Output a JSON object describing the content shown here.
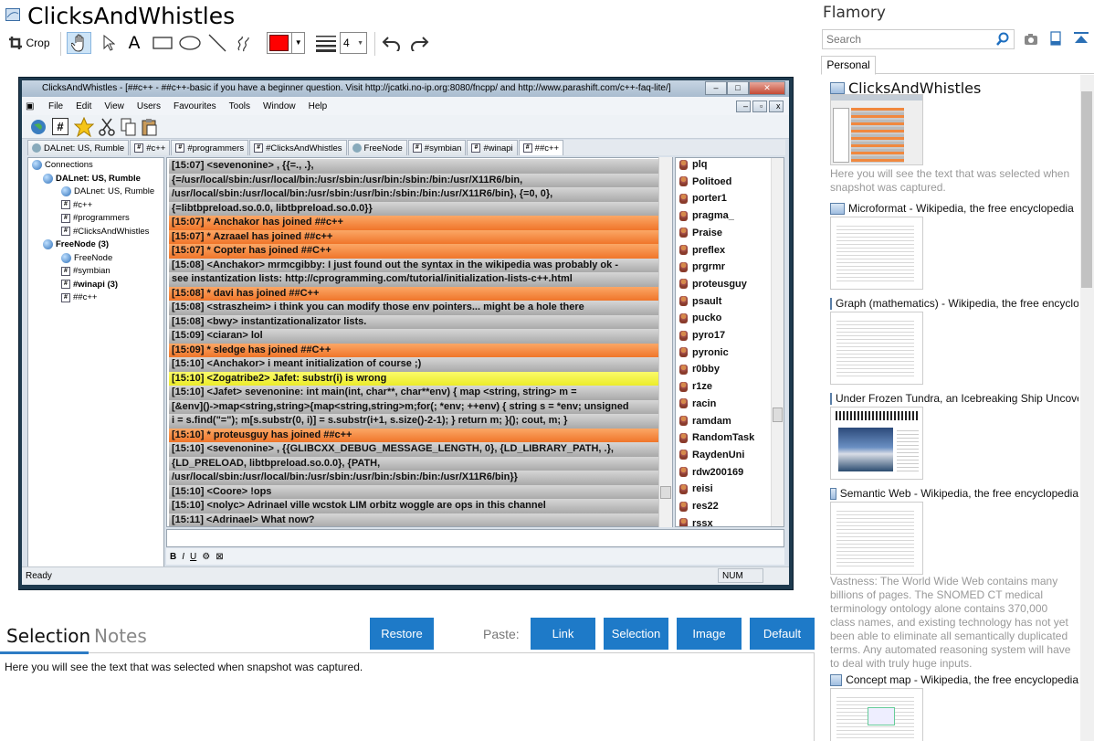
{
  "header": {
    "title": "ClicksAndWhistles",
    "toolbar": {
      "crop_label": "Crop",
      "tools": [
        "hand-icon",
        "pointer-icon",
        "text-icon",
        "rectangle-icon",
        "ellipse-icon",
        "line-icon",
        "freehand-icon"
      ],
      "color": "#ff0000",
      "line_width": "4"
    }
  },
  "screenshot": {
    "window_title": "ClicksAndWhistles - [##c++ - ##c++-basic if you have a beginner question. Visit http://jcatki.no-ip.org:8080/fncpp/ and http://www.parashift.com/c++-faq-lite/]",
    "menu": [
      "File",
      "Edit",
      "View",
      "Users",
      "Favourites",
      "Tools",
      "Window",
      "Help"
    ],
    "channel_tabs": [
      "DALnet: US, Rumble",
      "#c++",
      "#programmers",
      "#ClicksAndWhistles",
      "FreeNode",
      "#symbian",
      "#winapi",
      "##c++"
    ],
    "tree": [
      {
        "label": "Connections",
        "bold": false,
        "indent": 0
      },
      {
        "label": "DALnet: US, Rumble",
        "bold": true,
        "indent": 1
      },
      {
        "label": "DALnet: US, Rumble",
        "bold": false,
        "indent": 2
      },
      {
        "label": "#c++",
        "bold": false,
        "indent": 2
      },
      {
        "label": "#programmers",
        "bold": false,
        "indent": 2
      },
      {
        "label": "#ClicksAndWhistles",
        "bold": false,
        "indent": 2
      },
      {
        "label": "FreeNode (3)",
        "bold": true,
        "indent": 1
      },
      {
        "label": "FreeNode",
        "bold": false,
        "indent": 2
      },
      {
        "label": "#symbian",
        "bold": false,
        "indent": 2
      },
      {
        "label": "#winapi (3)",
        "bold": true,
        "indent": 2
      },
      {
        "label": "##c++",
        "bold": false,
        "indent": 2
      }
    ],
    "chat": [
      {
        "text": "[15:07] <sevenonine> , {{=., .},",
        "style": "grey"
      },
      {
        "text": "{=/usr/local/sbin:/usr/local/bin:/usr/sbin:/usr/bin:/sbin:/bin:/usr/X11R6/bin,",
        "style": "grey"
      },
      {
        "text": "/usr/local/sbin:/usr/local/bin:/usr/sbin:/usr/bin:/sbin:/bin:/usr/X11R6/bin}, {=0, 0},",
        "style": "grey"
      },
      {
        "text": "{=libtbpreload.so.0.0, libtbpreload.so.0.0}}",
        "style": "grey"
      },
      {
        "text": "[15:07] * Anchakor has joined ##c++",
        "style": "orange"
      },
      {
        "text": "[15:07] * Azraael has joined ##c++",
        "style": "orange"
      },
      {
        "text": "[15:07] * Copter has joined ##C++",
        "style": "orange"
      },
      {
        "text": "[15:08] <Anchakor> mrmcgibby: I just found out the syntax in the wikipedia was probably ok -",
        "style": "grey"
      },
      {
        "text": "see instantization lists: http://cprogramming.com/tutorial/initialization-lists-c++.html",
        "style": "grey"
      },
      {
        "text": "[15:08] * davi has joined ##C++",
        "style": "orange"
      },
      {
        "text": "[15:08] <straszheim> i think you can modify those env pointers... might be a hole there",
        "style": "grey"
      },
      {
        "text": "[15:08] <bwy> instantizationalizator lists.",
        "style": "grey"
      },
      {
        "text": "[15:09] <ciaran> lol",
        "style": "grey"
      },
      {
        "text": "[15:09] * sledge has joined ##C++",
        "style": "orange"
      },
      {
        "text": "[15:10] <Anchakor> i meant initialization of course ;)",
        "style": "grey"
      },
      {
        "text": "[15:10] <Zogatribe2> Jafet: substr(i) is wrong",
        "style": "yellow"
      },
      {
        "text": "[15:10] <Jafet> sevenonine: int main(int, char**, char**env) { map <string, string> m =",
        "style": "grey"
      },
      {
        "text": "[&env]()->map<string,string>{map<string,string>m;for(; *env; ++env) { string s = *env; unsigned",
        "style": "grey"
      },
      {
        "text": "i = s.find(\"=\"); m[s.substr(0, i)] = s.substr(i+1, s.size()-2-1); } return m; }(); cout, m; }",
        "style": "grey"
      },
      {
        "text": "[15:10] * proteusguy has joined ##c++",
        "style": "orange"
      },
      {
        "text": "[15:10] <sevenonine> , {{GLIBCXX_DEBUG_MESSAGE_LENGTH, 0}, {LD_LIBRARY_PATH, .},",
        "style": "grey"
      },
      {
        "text": "{LD_PRELOAD, libtbpreload.so.0.0}, {PATH,",
        "style": "grey"
      },
      {
        "text": "/usr/local/sbin:/usr/local/bin:/usr/sbin:/usr/bin:/sbin:/bin:/usr/X11R6/bin}}",
        "style": "grey"
      },
      {
        "text": "[15:10] <Coore> !ops",
        "style": "grey"
      },
      {
        "text": "[15:10] <nolyc> Adrinael ville wcstok LIM orbitz woggle are ops in this channel",
        "style": "grey"
      },
      {
        "text": "[15:11] <Adrinael> What now?",
        "style": "grey"
      }
    ],
    "users": [
      "plq",
      "Politoed",
      "porter1",
      "pragma_",
      "Praise",
      "preflex",
      "prgrmr",
      "proteusguy",
      "psault",
      "pucko",
      "pyro17",
      "pyronic",
      "r0bby",
      "r1ze",
      "racin",
      "ramdam",
      "RandomTask",
      "RaydenUni",
      "rdw200169",
      "reisi",
      "res22",
      "rssx"
    ],
    "status_left": "Ready",
    "status_right": "NUM"
  },
  "bottom": {
    "tab_selection": "Selection",
    "tab_notes": "Notes",
    "restore": "Restore",
    "paste_label": "Paste:",
    "paste_buttons": [
      "Link",
      "Selection",
      "Image",
      "Default"
    ],
    "selection_text": "Here you will see the text that was selected when snapshot was captured."
  },
  "right": {
    "title": "Flamory",
    "search_placeholder": "Search",
    "tab_personal": "Personal",
    "items": [
      {
        "title": "ClicksAndWhistles",
        "desc": "Here you will see the text that was selected when snapshot was captured."
      },
      {
        "title": "Microformat - Wikipedia, the free encyclopedia",
        "desc": ""
      },
      {
        "title": "Graph (mathematics) - Wikipedia, the free encyclopedia",
        "desc": ""
      },
      {
        "title": "Under Frozen Tundra, an Icebreaking Ship Uncovers",
        "desc": ""
      },
      {
        "title": "Semantic Web - Wikipedia, the free encyclopedia",
        "desc": "Vastness: The World Wide Web contains many billions of pages. The SNOMED CT medical terminology ontology alone contains 370,000 class names, and existing technology has not yet been able to eliminate all semantically duplicated terms. Any automated reasoning system will have to deal with truly huge inputs."
      },
      {
        "title": "Concept map - Wikipedia, the free encyclopedia",
        "desc": ""
      }
    ]
  },
  "colors": {
    "accent": "#1e7ac8",
    "orange": "#f5853a",
    "yellow": "#f7f73c",
    "grey": "#bdbdbd"
  }
}
